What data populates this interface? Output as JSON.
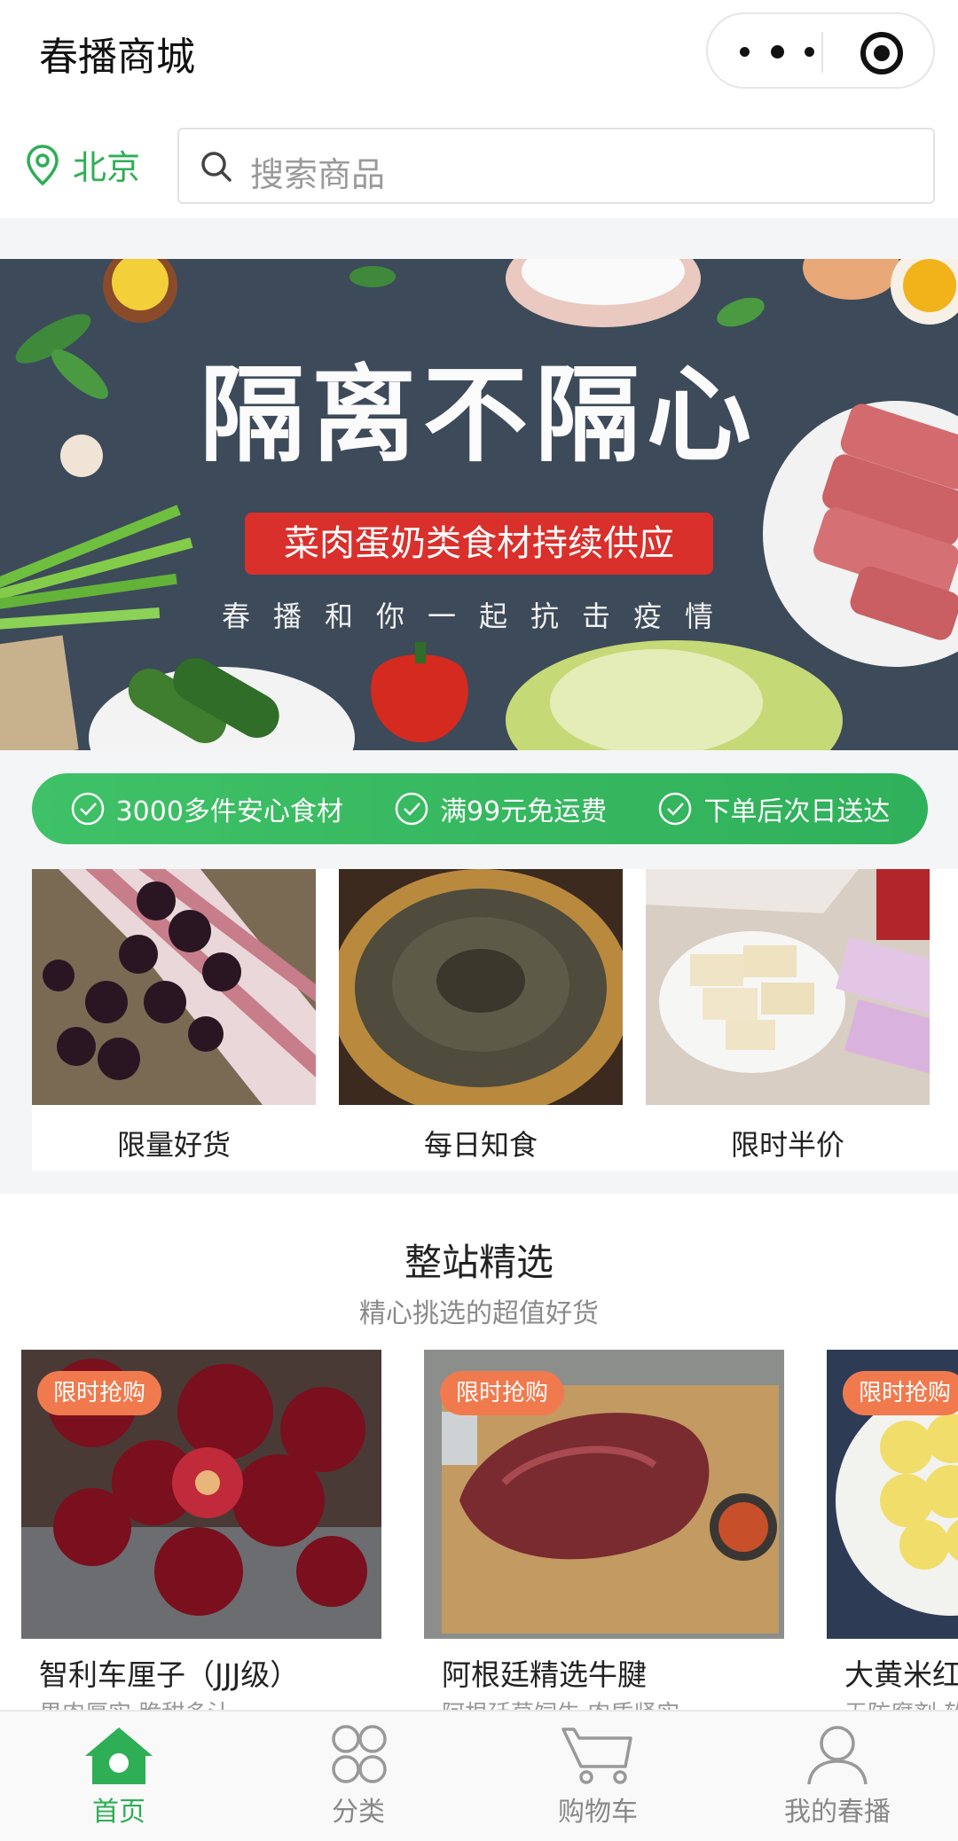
{
  "header": {
    "title": "春播商城"
  },
  "location": {
    "city": "北京"
  },
  "search": {
    "placeholder": "搜索商品"
  },
  "banner": {
    "title": "隔离不隔心",
    "highlight": "菜肉蛋奶类食材持续供应",
    "subtitle": "春播和你一起抗击疫情"
  },
  "promises": [
    {
      "text": "3000多件安心食材"
    },
    {
      "text": "满99元免运费"
    },
    {
      "text": "下单后次日送达"
    }
  ],
  "categories": [
    {
      "label": "限量好货"
    },
    {
      "label": "每日知食"
    },
    {
      "label": "限时半价"
    }
  ],
  "section": {
    "title": "整站精选",
    "subtitle": "精心挑选的超值好货"
  },
  "products": [
    {
      "badge": "限时抢购",
      "name": "智利车厘子（JJJ级）",
      "desc": "果肉厚实 脆甜多汁"
    },
    {
      "badge": "限时抢购",
      "name": "阿根廷精选牛腱",
      "desc": "阿根廷草饲牛 肉质紧实"
    },
    {
      "badge": "限时抢购",
      "name": "大黄米红",
      "desc": "无防腐剂 软"
    }
  ],
  "tabs": [
    {
      "label": "首页"
    },
    {
      "label": "分类"
    },
    {
      "label": "购物车"
    },
    {
      "label": "我的春播"
    }
  ],
  "colors": {
    "accent": "#2eae55",
    "badge": "#f07a4e",
    "banner_red": "#d9302c"
  }
}
